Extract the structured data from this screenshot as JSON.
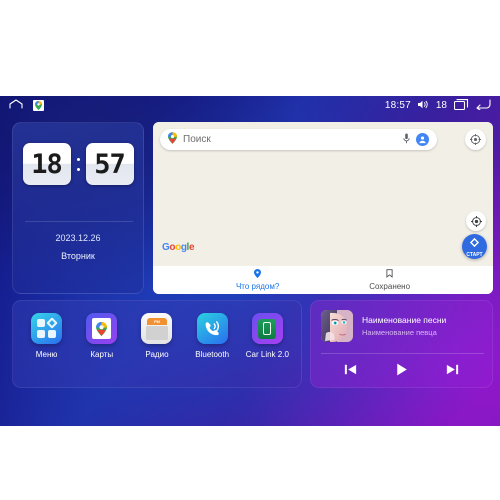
{
  "statusbar": {
    "home_icon": "home-icon",
    "maps_notification_icon": "google-maps-notification-icon",
    "time": "18:57",
    "volume_icon": "volume-icon",
    "volume_level": "18",
    "recents_icon": "recents-icon",
    "back_icon": "back-icon"
  },
  "clock_widget": {
    "hours": "18",
    "minutes": "57",
    "date": "2023.12.26",
    "weekday": "Вторник"
  },
  "map_widget": {
    "search_placeholder": "Поиск",
    "search_value": "",
    "pin_icon": "map-pin-icon",
    "mic_icon": "microphone-icon",
    "avatar_icon": "account-avatar-icon",
    "layers_icon": "map-layers-icon",
    "locate_icon": "my-location-icon",
    "start_button_label": "СТАРТ",
    "start_icon": "navigation-arrow-icon",
    "google_logo": [
      "G",
      "o",
      "o",
      "g",
      "l",
      "e"
    ],
    "bottom_nav": [
      {
        "label": "Что рядом?",
        "icon": "nearby-pin-icon",
        "active": true
      },
      {
        "label": "Сохранено",
        "icon": "bookmark-icon",
        "active": false
      }
    ]
  },
  "apps": [
    {
      "label": "Меню",
      "icon": "menu-grid-icon"
    },
    {
      "label": "Карты",
      "icon": "google-maps-icon"
    },
    {
      "label": "Радио",
      "icon": "radio-icon",
      "badge": "FM"
    },
    {
      "label": "Bluetooth",
      "icon": "bluetooth-phone-icon"
    },
    {
      "label": "Car Link 2.0",
      "icon": "car-link-icon"
    }
  ],
  "music_widget": {
    "album_art": "album-art-portrait",
    "title": "Наименование песни",
    "artist": "Наименование певца",
    "controls": [
      {
        "name": "previous-track-button",
        "icon": "skip-previous-icon"
      },
      {
        "name": "play-button",
        "icon": "play-icon"
      },
      {
        "name": "next-track-button",
        "icon": "skip-next-icon"
      }
    ]
  },
  "colors": {
    "bg_blue": "#151a8c",
    "bg_purple": "#7a14b0",
    "map_bg": "#f2f0e7",
    "accent_blue": "#1a73e8",
    "start_blue": "#2f6ae0",
    "radio_orange": "#f29131"
  }
}
